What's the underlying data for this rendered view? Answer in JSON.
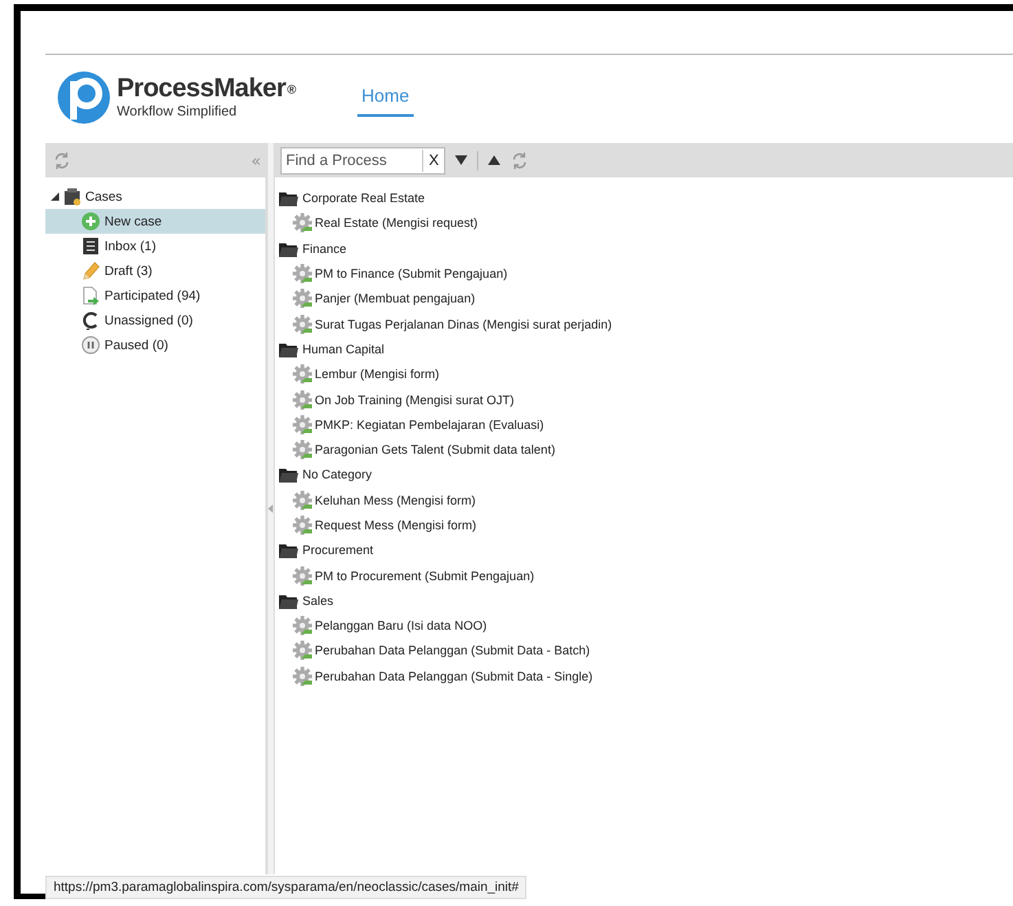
{
  "header": {
    "logo_name": "ProcessMaker",
    "logo_mark": "®",
    "logo_tagline": "Workflow Simplified",
    "nav": [
      {
        "label": "Home",
        "selected": true
      }
    ]
  },
  "sidebar": {
    "collapse": "«",
    "tree": [
      {
        "label": "Cases",
        "expanded": true,
        "children": [
          {
            "label": "New case",
            "kind": "new",
            "selected": true
          },
          {
            "label": "Inbox (1)",
            "kind": "inbox",
            "selected": false
          },
          {
            "label": "Draft (3)",
            "kind": "draft",
            "selected": false
          },
          {
            "label": "Participated (94)",
            "kind": "participated",
            "selected": false
          },
          {
            "label": "Unassigned (0)",
            "kind": "unassigned",
            "selected": false
          },
          {
            "label": "Paused (0)",
            "kind": "paused",
            "selected": false
          }
        ]
      }
    ]
  },
  "toolbar": {
    "search": {
      "placeholder": "Find a Process"
    },
    "clear": "X"
  },
  "categories": [
    {
      "name": "Corporate Real Estate",
      "processes": [
        "Real Estate (Mengisi request)"
      ]
    },
    {
      "name": "Finance",
      "processes": [
        "PM to Finance (Submit Pengajuan)",
        "Panjer (Membuat pengajuan)",
        "Surat Tugas Perjalanan Dinas (Mengisi surat perjadin)"
      ]
    },
    {
      "name": "Human Capital",
      "processes": [
        "Lembur (Mengisi form)",
        "On Job Training (Mengisi surat OJT)",
        "PMKP: Kegiatan Pembelajaran (Evaluasi)",
        "Paragonian Gets Talent (Submit data talent)"
      ]
    },
    {
      "name": "No Category",
      "processes": [
        "Keluhan Mess (Mengisi form)",
        "Request Mess (Mengisi form)"
      ]
    },
    {
      "name": "Procurement",
      "processes": [
        "PM to Procurement (Submit Pengajuan)"
      ]
    },
    {
      "name": "Sales",
      "processes": [
        "Pelanggan Baru (Isi data NOO)",
        "Perubahan Data Pelanggan (Submit Data - Batch)",
        "Perubahan Data Pelanggan (Submit Data - Single)"
      ]
    }
  ],
  "status_bar": {
    "url": "https://pm3.paramaglobalinspira.com/sysparama/en/neoclassic/cases/main_init#"
  }
}
